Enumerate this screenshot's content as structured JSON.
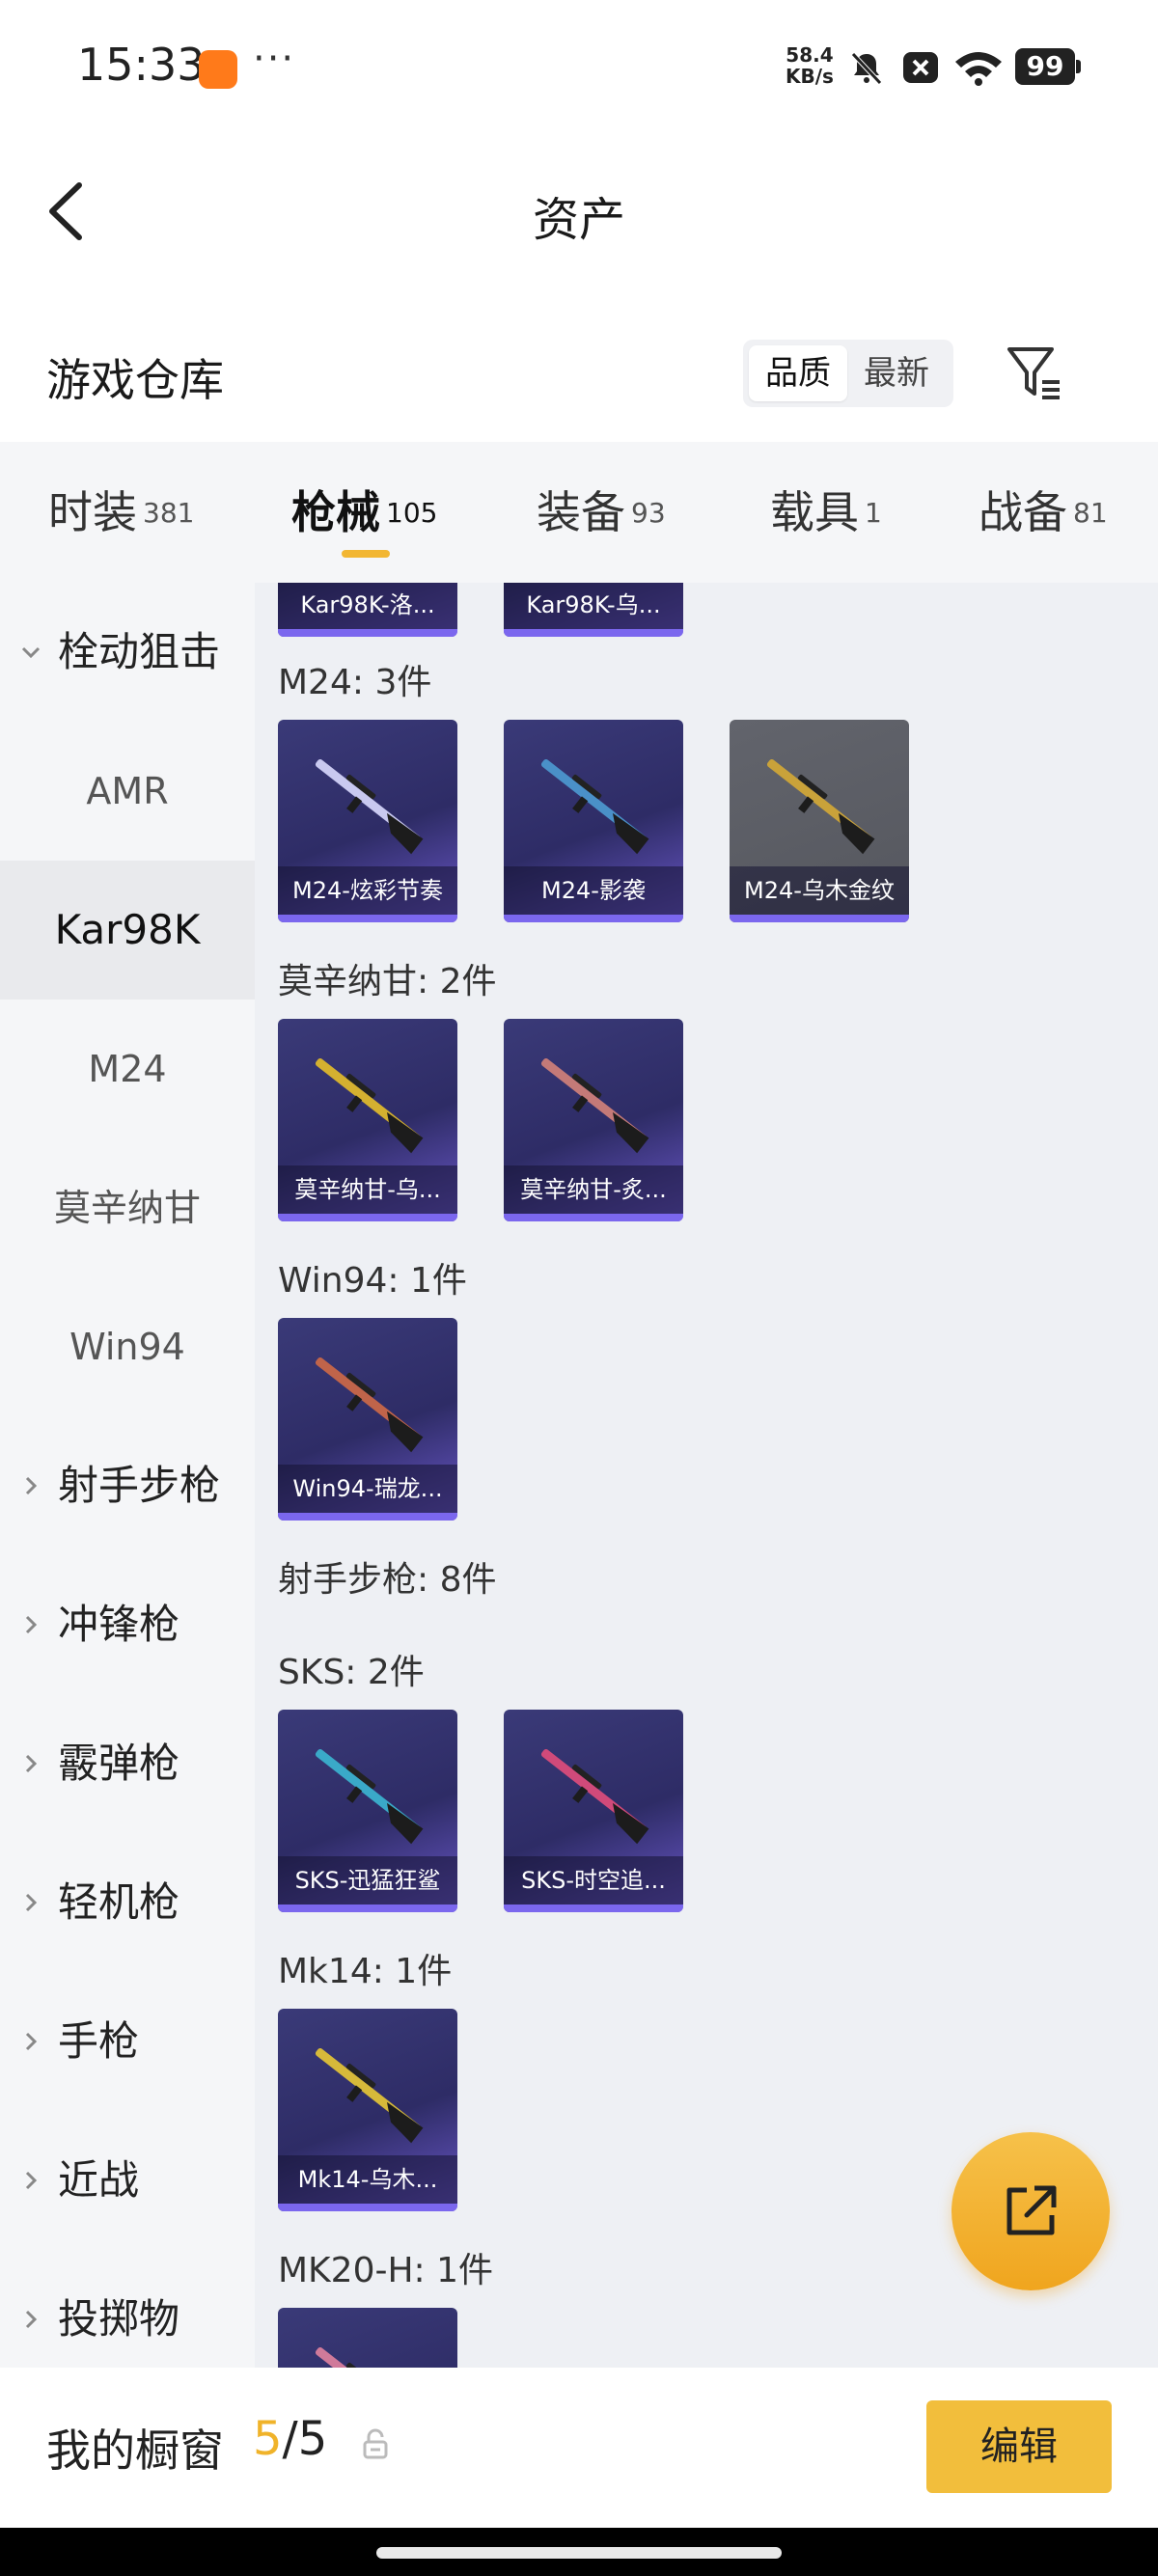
{
  "status_bar": {
    "time": "15:33",
    "dots": "···",
    "speed_value": "58.4",
    "speed_unit": "KB/s",
    "battery": "99"
  },
  "header": {
    "title": "资产"
  },
  "section": {
    "title": "游戏仓库",
    "sort_options": [
      "品质",
      "最新"
    ],
    "sort_selected": "品质"
  },
  "tabs": [
    {
      "label": "时装",
      "count": "381"
    },
    {
      "label": "枪械",
      "count": "105"
    },
    {
      "label": "装备",
      "count": "93"
    },
    {
      "label": "载具",
      "count": "1"
    },
    {
      "label": "战备",
      "count": "81"
    }
  ],
  "active_tab": "枪械",
  "sidebar": [
    {
      "label": "栓动狙击",
      "type": "group",
      "expanded": true
    },
    {
      "label": "AMR",
      "type": "sub"
    },
    {
      "label": "Kar98K",
      "type": "sub",
      "active": true
    },
    {
      "label": "M24",
      "type": "sub"
    },
    {
      "label": "莫辛纳甘",
      "type": "sub"
    },
    {
      "label": "Win94",
      "type": "sub"
    },
    {
      "label": "射手步枪",
      "type": "group"
    },
    {
      "label": "冲锋枪",
      "type": "group"
    },
    {
      "label": "霰弹枪",
      "type": "group"
    },
    {
      "label": "轻机枪",
      "type": "group"
    },
    {
      "label": "手枪",
      "type": "group"
    },
    {
      "label": "近战",
      "type": "group"
    },
    {
      "label": "投掷物",
      "type": "group"
    }
  ],
  "content": {
    "top_partial_items": [
      "Kar98K-洛...",
      "Kar98K-乌..."
    ],
    "groups": [
      {
        "label": "M24: 3件",
        "items": [
          {
            "name": "M24-炫彩节奏",
            "tone": "purple",
            "gun_color": "#c9c9f0"
          },
          {
            "name": "M24-影袭",
            "tone": "purple",
            "gun_color": "#4a90c8"
          },
          {
            "name": "M24-乌木金纹",
            "tone": "grey",
            "gun_color": "#c9a23a"
          }
        ]
      },
      {
        "label": "莫辛纳甘: 2件",
        "items": [
          {
            "name": "莫辛纳甘-乌...",
            "tone": "purple",
            "gun_color": "#d4b030"
          },
          {
            "name": "莫辛纳甘-炙...",
            "tone": "purple",
            "gun_color": "#c47a78"
          }
        ]
      },
      {
        "label": "Win94: 1件",
        "items": [
          {
            "name": "Win94-瑞龙...",
            "tone": "purple",
            "gun_color": "#c0644a"
          }
        ]
      },
      {
        "label": "射手步枪: 8件",
        "items": []
      },
      {
        "label": "SKS: 2件",
        "items": [
          {
            "name": "SKS-迅猛狂鲨",
            "tone": "purple",
            "gun_color": "#3aa9c8"
          },
          {
            "name": "SKS-时空追...",
            "tone": "purple",
            "gun_color": "#d04a7a"
          }
        ]
      },
      {
        "label": "Mk14: 1件",
        "items": [
          {
            "name": "Mk14-乌木...",
            "tone": "purple",
            "gun_color": "#d6b93a"
          }
        ]
      },
      {
        "label": "MK20-H: 1件",
        "items": [
          {
            "name": "",
            "tone": "purple",
            "gun_color": "#d07a9a"
          }
        ]
      }
    ]
  },
  "bottom_bar": {
    "label": "我的橱窗",
    "current": "5",
    "separator": "/",
    "total": "5",
    "edit_label": "编辑"
  }
}
